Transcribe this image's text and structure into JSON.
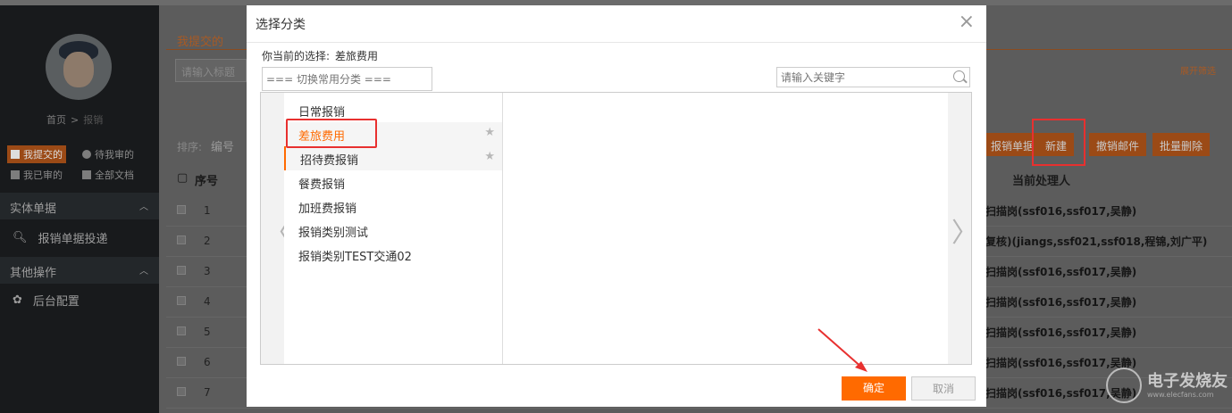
{
  "sidebar": {
    "breadcrumb": {
      "home": "首页",
      "sep": ">",
      "current": "报销"
    },
    "mini_nav": [
      {
        "label": "我提交的",
        "active": true
      },
      {
        "label": "待我审的",
        "active": false
      },
      {
        "label": "我已审的",
        "active": false
      },
      {
        "label": "全部文档",
        "active": false
      }
    ],
    "sections": [
      {
        "title": "实体单据",
        "items": [
          "报销单据投递"
        ]
      },
      {
        "title": "其他操作",
        "items": [
          "后台配置"
        ]
      }
    ]
  },
  "main": {
    "tab_mine": "我提交的",
    "title_placeholder": "请输入标题",
    "filter_link": "展开筛选",
    "sort_label": "排序:",
    "sort_code": "编号",
    "actions": [
      "报销单据",
      "新建",
      "撤销邮件",
      "批量删除"
    ],
    "columns": {
      "seq": "序号",
      "handler": "当前处理人"
    },
    "rows": [
      {
        "num": "1",
        "handler": "扫描岗(ssf016,ssf017,吴静)"
      },
      {
        "num": "2",
        "handler": "复核)(jiangs,ssf021,ssf018,程锦,刘广平)"
      },
      {
        "num": "3",
        "handler": "扫描岗(ssf016,ssf017,吴静)"
      },
      {
        "num": "4",
        "handler": "扫描岗(ssf016,ssf017,吴静)"
      },
      {
        "num": "5",
        "handler": "扫描岗(ssf016,ssf017,吴静)"
      },
      {
        "num": "6",
        "handler": "扫描岗(ssf016,ssf017,吴静)"
      },
      {
        "num": "7",
        "handler": "扫描岗(ssf016,ssf017,吴静)"
      }
    ]
  },
  "modal": {
    "title": "选择分类",
    "close": "×",
    "current_label": "你当前的选择:",
    "current_value": "差旅费用",
    "switch_placeholder": "=== 切换常用分类 ===",
    "keyword_placeholder": "请输入关键字",
    "prev_arrow": "〈",
    "next_arrow": "〉",
    "categories": [
      {
        "label": "日常报销",
        "state": "normal",
        "star": false
      },
      {
        "label": "差旅费用",
        "state": "selected",
        "star": true
      },
      {
        "label": "招待费报销",
        "state": "bar",
        "star": true
      },
      {
        "label": "餐费报销",
        "state": "normal",
        "star": false
      },
      {
        "label": "加班费报销",
        "state": "normal",
        "star": false
      },
      {
        "label": "报销类别测试",
        "state": "normal",
        "star": false
      },
      {
        "label": "报销类别TEST交通02",
        "state": "normal",
        "star": false
      }
    ],
    "star_glyph": "★",
    "ok_label": "确定",
    "cancel_label": "取消"
  },
  "watermark": {
    "title": "电子发烧友",
    "sub": "www.elecfans.com"
  },
  "colors": {
    "accent": "#ff6a00",
    "annotation": "#e8302f",
    "overlay_bg": "#4a4a4a"
  }
}
